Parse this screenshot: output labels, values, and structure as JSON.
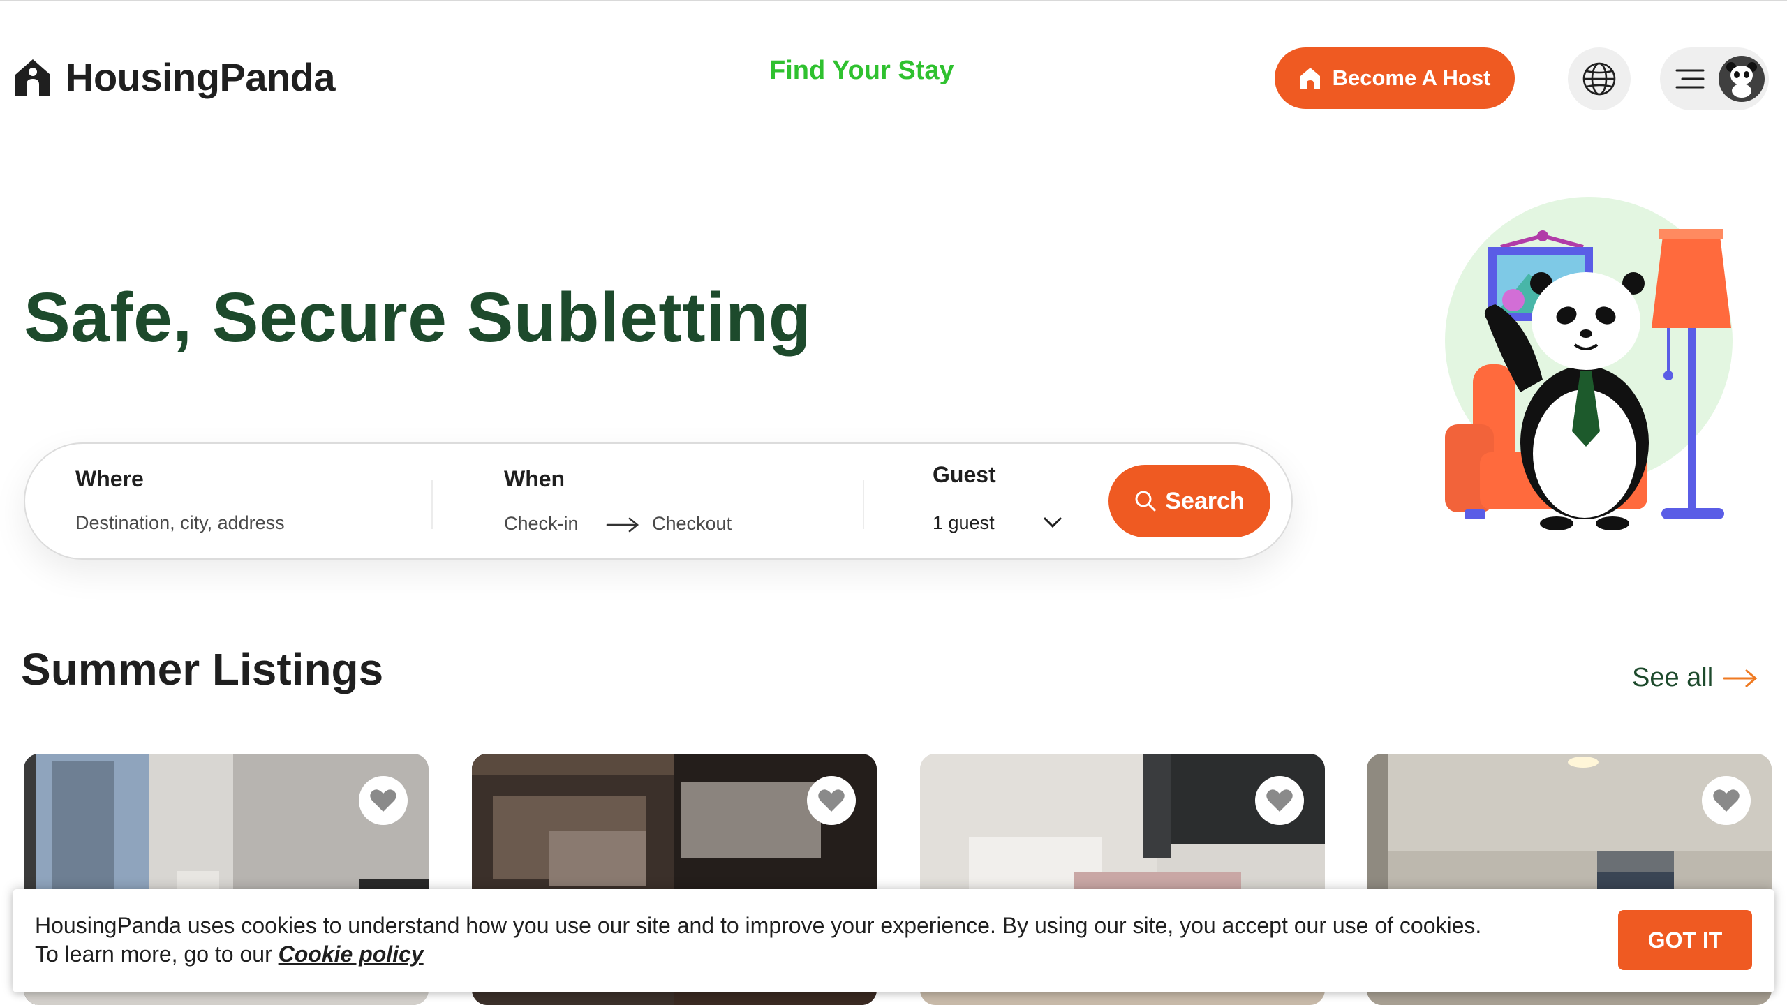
{
  "header": {
    "brand": "HousingPanda",
    "nav_link": "Find Your Stay",
    "host_button": "Become A Host",
    "globe_icon": "globe-icon",
    "menu_icon": "hamburger-menu-icon",
    "avatar_icon": "panda-avatar-icon"
  },
  "hero": {
    "title": "Safe, Secure Subletting"
  },
  "search": {
    "where_label": "Where",
    "where_placeholder": "Destination, city, address",
    "when_label": "When",
    "checkin": "Check-in",
    "checkout": "Checkout",
    "guest_label": "Guest",
    "guest_value": "1 guest",
    "button": "Search"
  },
  "listings": {
    "title": "Summer Listings",
    "see_all": "See all",
    "cards": [
      {
        "favorite_icon": "heart-icon"
      },
      {
        "favorite_icon": "heart-icon"
      },
      {
        "favorite_icon": "heart-icon"
      },
      {
        "favorite_icon": "heart-icon"
      }
    ]
  },
  "cookie": {
    "line1": "HousingPanda uses cookies to understand how you use our site and to improve your experience. By using our site, you accept our use of cookies.",
    "line2_prefix": "To learn more, go to our ",
    "link": "Cookie policy",
    "button": "GOT IT"
  },
  "colors": {
    "accent": "#ef5a22",
    "brand_green": "#1d4a2c",
    "nav_green": "#2fc12f"
  }
}
